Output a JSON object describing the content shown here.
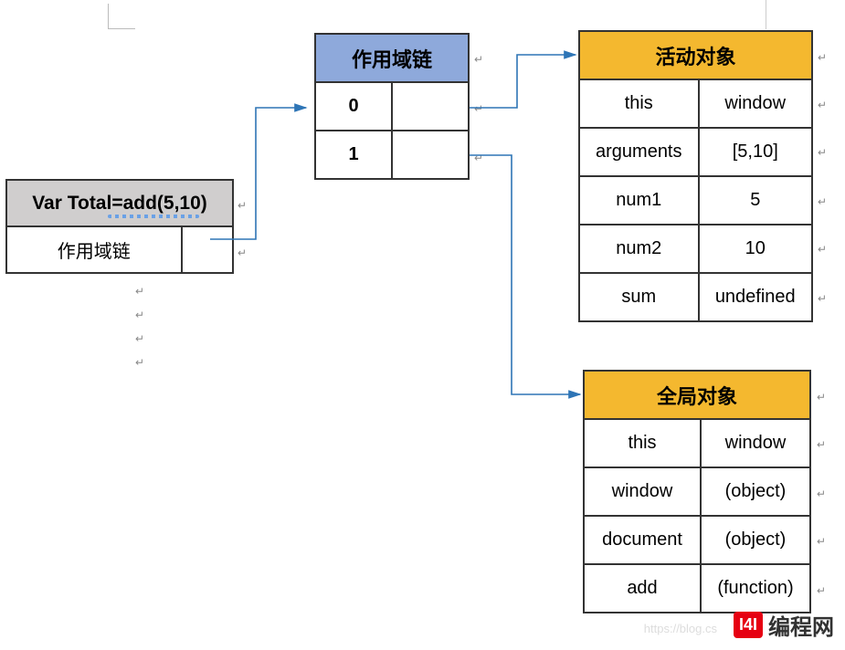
{
  "source_box": {
    "title": "Var Total=add(5,10)",
    "scope_label": "作用域链"
  },
  "scope_chain": {
    "title": "作用域链",
    "rows": [
      {
        "index": "0",
        "ref": ""
      },
      {
        "index": "1",
        "ref": ""
      }
    ]
  },
  "active_object": {
    "title": "活动对象",
    "rows": [
      {
        "key": "this",
        "value": "window"
      },
      {
        "key": "arguments",
        "value": "[5,10]"
      },
      {
        "key": "num1",
        "value": "5"
      },
      {
        "key": "num2",
        "value": "10"
      },
      {
        "key": "sum",
        "value": "undefined"
      }
    ]
  },
  "global_object": {
    "title": "全局对象",
    "rows": [
      {
        "key": "this",
        "value": "window"
      },
      {
        "key": "window",
        "value": "(object)"
      },
      {
        "key": "document",
        "value": "(object)"
      },
      {
        "key": "add",
        "value": "(function)"
      }
    ]
  },
  "watermark": {
    "url": "https://blog.cs",
    "badge": "I4I",
    "text": "编程网"
  },
  "colors": {
    "grey": "#d0cece",
    "blue": "#8ea9db",
    "orange": "#f4b82f",
    "arrow": "#2e75b6"
  }
}
